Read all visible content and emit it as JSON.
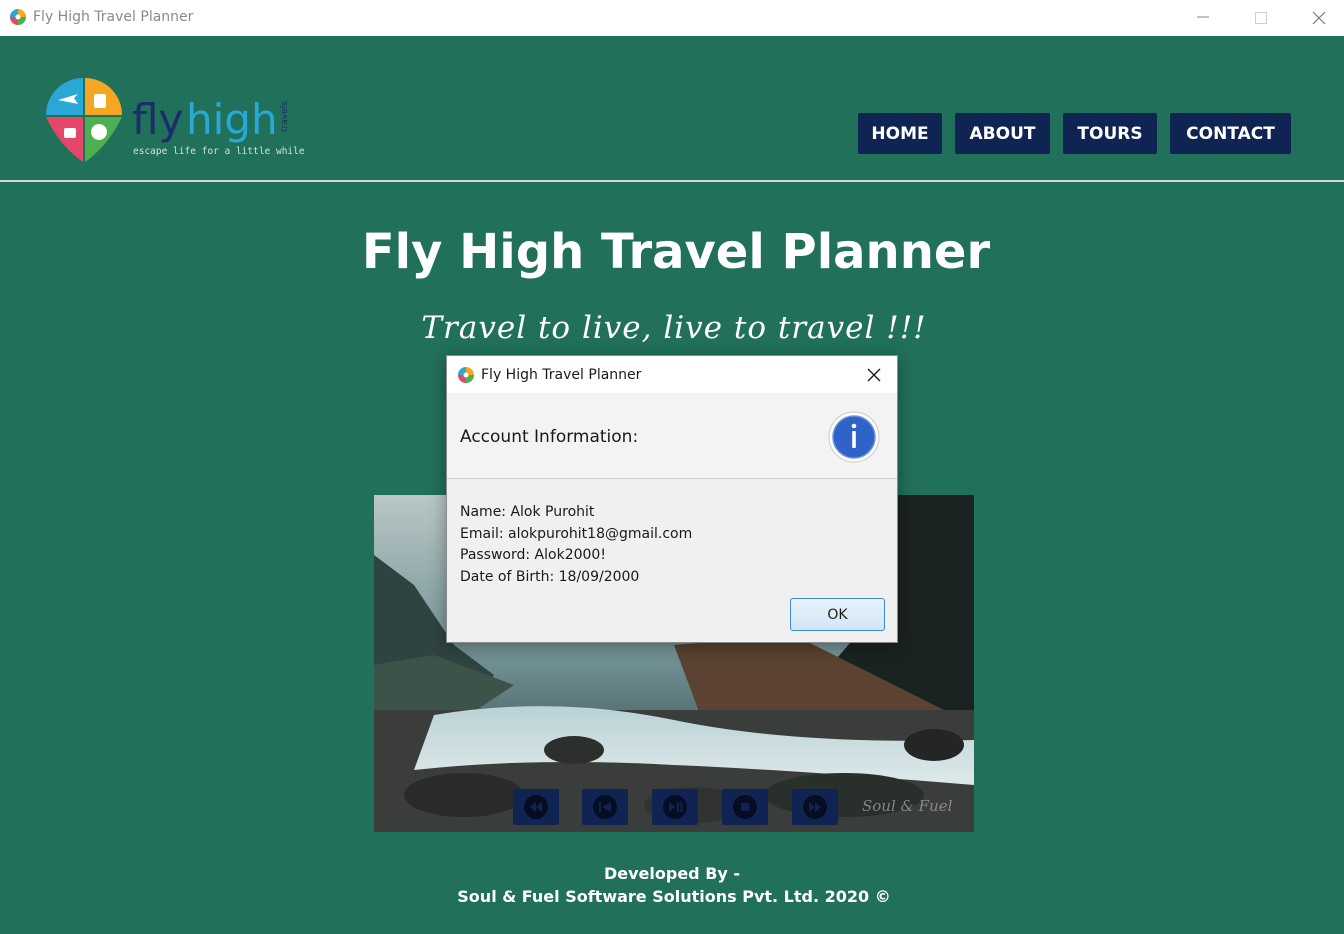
{
  "window": {
    "title": "Fly High Travel Planner",
    "minimize_icon": "minimize-icon",
    "maximize_icon": "maximize-icon",
    "close_icon": "close-icon"
  },
  "logo": {
    "brand_part1": "fly",
    "brand_part2": "high",
    "vertical_text": "travels",
    "slogan": "escape life for a little while"
  },
  "nav": {
    "home": "HOME",
    "about": "ABOUT",
    "tours": "TOURS",
    "contact": "CONTACT"
  },
  "main": {
    "title": "Fly High Travel Planner",
    "tagline": "Travel to live, live to travel !!!"
  },
  "video": {
    "watermark": "Soul & Fuel",
    "controls": [
      "rewind-icon",
      "previous-icon",
      "play-pause-icon",
      "stop-icon",
      "fast-forward-icon"
    ]
  },
  "footer": {
    "line1": "Developed By -",
    "line2": "Soul & Fuel Software Solutions Pvt. Ltd. 2020 ©"
  },
  "dialog": {
    "title": "Fly High Travel Planner",
    "header": "Account Information:",
    "lines": [
      "Name: Alok Purohit",
      "Email: alokpurohit18@gmail.com",
      "Password: Alok2000!",
      "Date of Birth: 18/09/2000"
    ],
    "ok_label": "OK"
  },
  "colors": {
    "background": "#21705a",
    "nav_button": "#0f2453",
    "info_icon": "#2f63c8"
  }
}
